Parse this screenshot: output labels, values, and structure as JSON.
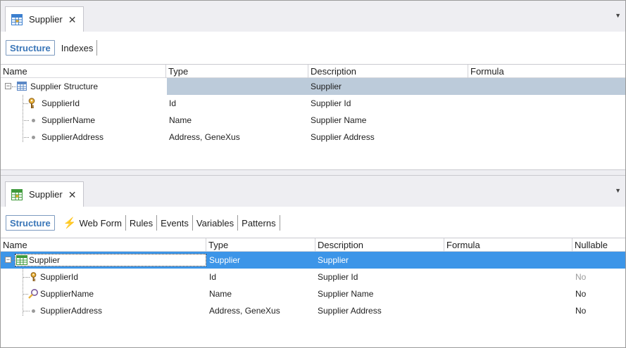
{
  "top_panel": {
    "tab_title": "Supplier",
    "close_glyph": "✕",
    "tab_icon": "table-icon",
    "subtabs": [
      "Structure",
      "Indexes"
    ],
    "columns": [
      "Name",
      "Type",
      "Description",
      "Formula"
    ],
    "rows": [
      {
        "name": "Supplier Structure",
        "type": "",
        "description": "Supplier",
        "formula": "",
        "icon": "structure-icon"
      },
      {
        "name": "SupplierId",
        "type": "Id",
        "description": "Supplier Id",
        "formula": "",
        "icon": "key-icon"
      },
      {
        "name": "SupplierName",
        "type": "Name",
        "description": "Supplier Name",
        "formula": "",
        "icon": "dot-icon"
      },
      {
        "name": "SupplierAddress",
        "type": "Address, GeneXus",
        "description": "Supplier Address",
        "formula": "",
        "icon": "dot-icon"
      }
    ]
  },
  "bottom_panel": {
    "tab_title": "Supplier",
    "close_glyph": "✕",
    "tab_icon": "transaction-icon",
    "subtabs": [
      "Structure",
      "Web Form",
      "Rules",
      "Events",
      "Variables",
      "Patterns"
    ],
    "columns": [
      "Name",
      "Type",
      "Description",
      "Formula",
      "Nullable"
    ],
    "rows": [
      {
        "name": "Supplier",
        "type": "Supplier",
        "description": "Supplier",
        "formula": "",
        "nullable": "",
        "icon": "level-icon"
      },
      {
        "name": "SupplierId",
        "type": "Id",
        "description": "Supplier Id",
        "formula": "",
        "nullable": "No",
        "icon": "key-icon"
      },
      {
        "name": "SupplierName",
        "type": "Name",
        "description": "Supplier Name",
        "formula": "",
        "nullable": "No",
        "icon": "search-key-icon"
      },
      {
        "name": "SupplierAddress",
        "type": "Address, GeneXus",
        "description": "Supplier Address",
        "formula": "",
        "nullable": "No",
        "icon": "dot-icon"
      }
    ]
  },
  "colors": {
    "selected_row_blue": "#3c95e8",
    "selected_row_gray": "#bccbda",
    "active_subtab_text": "#3a76b8",
    "web_form_bolt": "#f08c1c"
  }
}
